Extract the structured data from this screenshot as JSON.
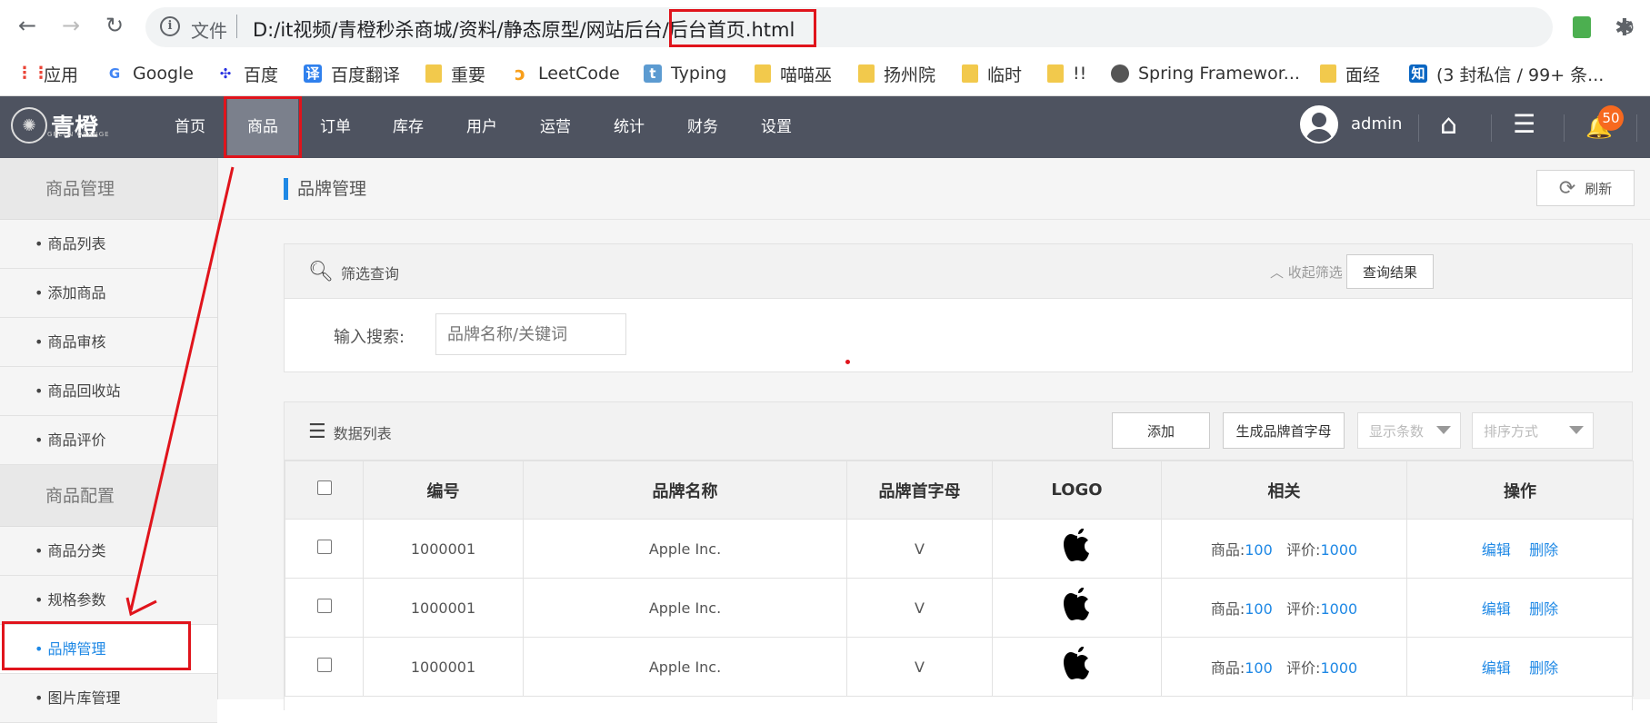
{
  "browser": {
    "back": "←",
    "forward": "→",
    "reload": "↻",
    "info": "i",
    "file_label": "文件",
    "url": "D:/it视频/青橙秒杀商城/资料/静态原型/网站后台/后台首页.html",
    "zoom_icon": "⊖",
    "star_icon": "☆",
    "ext_icon": "✱"
  },
  "bookmarks": [
    {
      "label": "应用",
      "icon": "apps-icon",
      "color": "#4285f4"
    },
    {
      "label": "Google",
      "icon": "google-icon",
      "color": "#4285f4"
    },
    {
      "label": "百度",
      "icon": "baidu-icon",
      "color": "#2932e1"
    },
    {
      "label": "百度翻译",
      "icon": "translate-icon",
      "color": "#2f80ed"
    },
    {
      "label": "重要",
      "icon": "folder-icon",
      "color": "#f2c94c"
    },
    {
      "label": "LeetCode",
      "icon": "leetcode-icon",
      "color": "#f89f1b"
    },
    {
      "label": "Typing",
      "icon": "typing-icon",
      "color": "#5c9bd1"
    },
    {
      "label": "喵喵巫",
      "icon": "folder-icon",
      "color": "#f2c94c"
    },
    {
      "label": "扬州院",
      "icon": "folder-icon",
      "color": "#f2c94c"
    },
    {
      "label": "临时",
      "icon": "folder-icon",
      "color": "#f2c94c"
    },
    {
      "label": "!!",
      "icon": "folder-icon",
      "color": "#f2c94c"
    },
    {
      "label": "Spring Framewor...",
      "icon": "globe-icon",
      "color": "#555"
    },
    {
      "label": "面经",
      "icon": "folder-icon",
      "color": "#f2c94c"
    },
    {
      "label": "(3 封私信 / 99+ 条...",
      "icon": "zhihu-icon",
      "color": "#0a66c2"
    }
  ],
  "header": {
    "logo_text": "青橙",
    "logo_sub": "GREEN ORANGE",
    "nav": [
      "首页",
      "商品",
      "订单",
      "库存",
      "用户",
      "运营",
      "统计",
      "财务",
      "设置"
    ],
    "active_nav": "商品",
    "user_name": "admin",
    "home_icon": "⌂",
    "menu_icon": "☰",
    "bell_icon": "🔔",
    "notification_count": "50"
  },
  "sidebar": {
    "group1": "商品管理",
    "group1_items": [
      "商品列表",
      "添加商品",
      "商品审核",
      "商品回收站",
      "商品评价"
    ],
    "group2": "商品配置",
    "group2_items": [
      "商品分类",
      "规格参数",
      "品牌管理",
      "图片库管理"
    ],
    "active_item": "品牌管理"
  },
  "page": {
    "title": "品牌管理",
    "refresh_label": "刷新"
  },
  "filter": {
    "title": "筛选查询",
    "collapse_label": "收起筛选",
    "query_button": "查询结果",
    "search_label": "输入搜索:",
    "search_placeholder": "品牌名称/关键词"
  },
  "data_list": {
    "title": "数据列表",
    "add_button": "添加",
    "gen_button": "生成品牌首字母",
    "page_size_placeholder": "显示条数",
    "sort_placeholder": "排序方式",
    "columns": [
      "编号",
      "品牌名称",
      "品牌首字母",
      "LOGO",
      "相关",
      "操作"
    ],
    "rows": [
      {
        "id": "1000001",
        "name": "Apple Inc.",
        "letter": "V",
        "goods_label": "商品:",
        "goods": "100",
        "review_label": "评价:",
        "reviews": "1000",
        "edit": "编辑",
        "delete": "删除"
      },
      {
        "id": "1000001",
        "name": "Apple Inc.",
        "letter": "V",
        "goods_label": "商品:",
        "goods": "100",
        "review_label": "评价:",
        "reviews": "1000",
        "edit": "编辑",
        "delete": "删除"
      },
      {
        "id": "1000001",
        "name": "Apple Inc.",
        "letter": "V",
        "goods_label": "商品:",
        "goods": "100",
        "review_label": "评价:",
        "reviews": "1000",
        "edit": "编辑",
        "delete": "删除"
      }
    ]
  },
  "colors": {
    "header_bg": "#4e5360",
    "accent": "#1e88e5",
    "annotation_red": "#e0141c",
    "badge": "#f7691f"
  }
}
